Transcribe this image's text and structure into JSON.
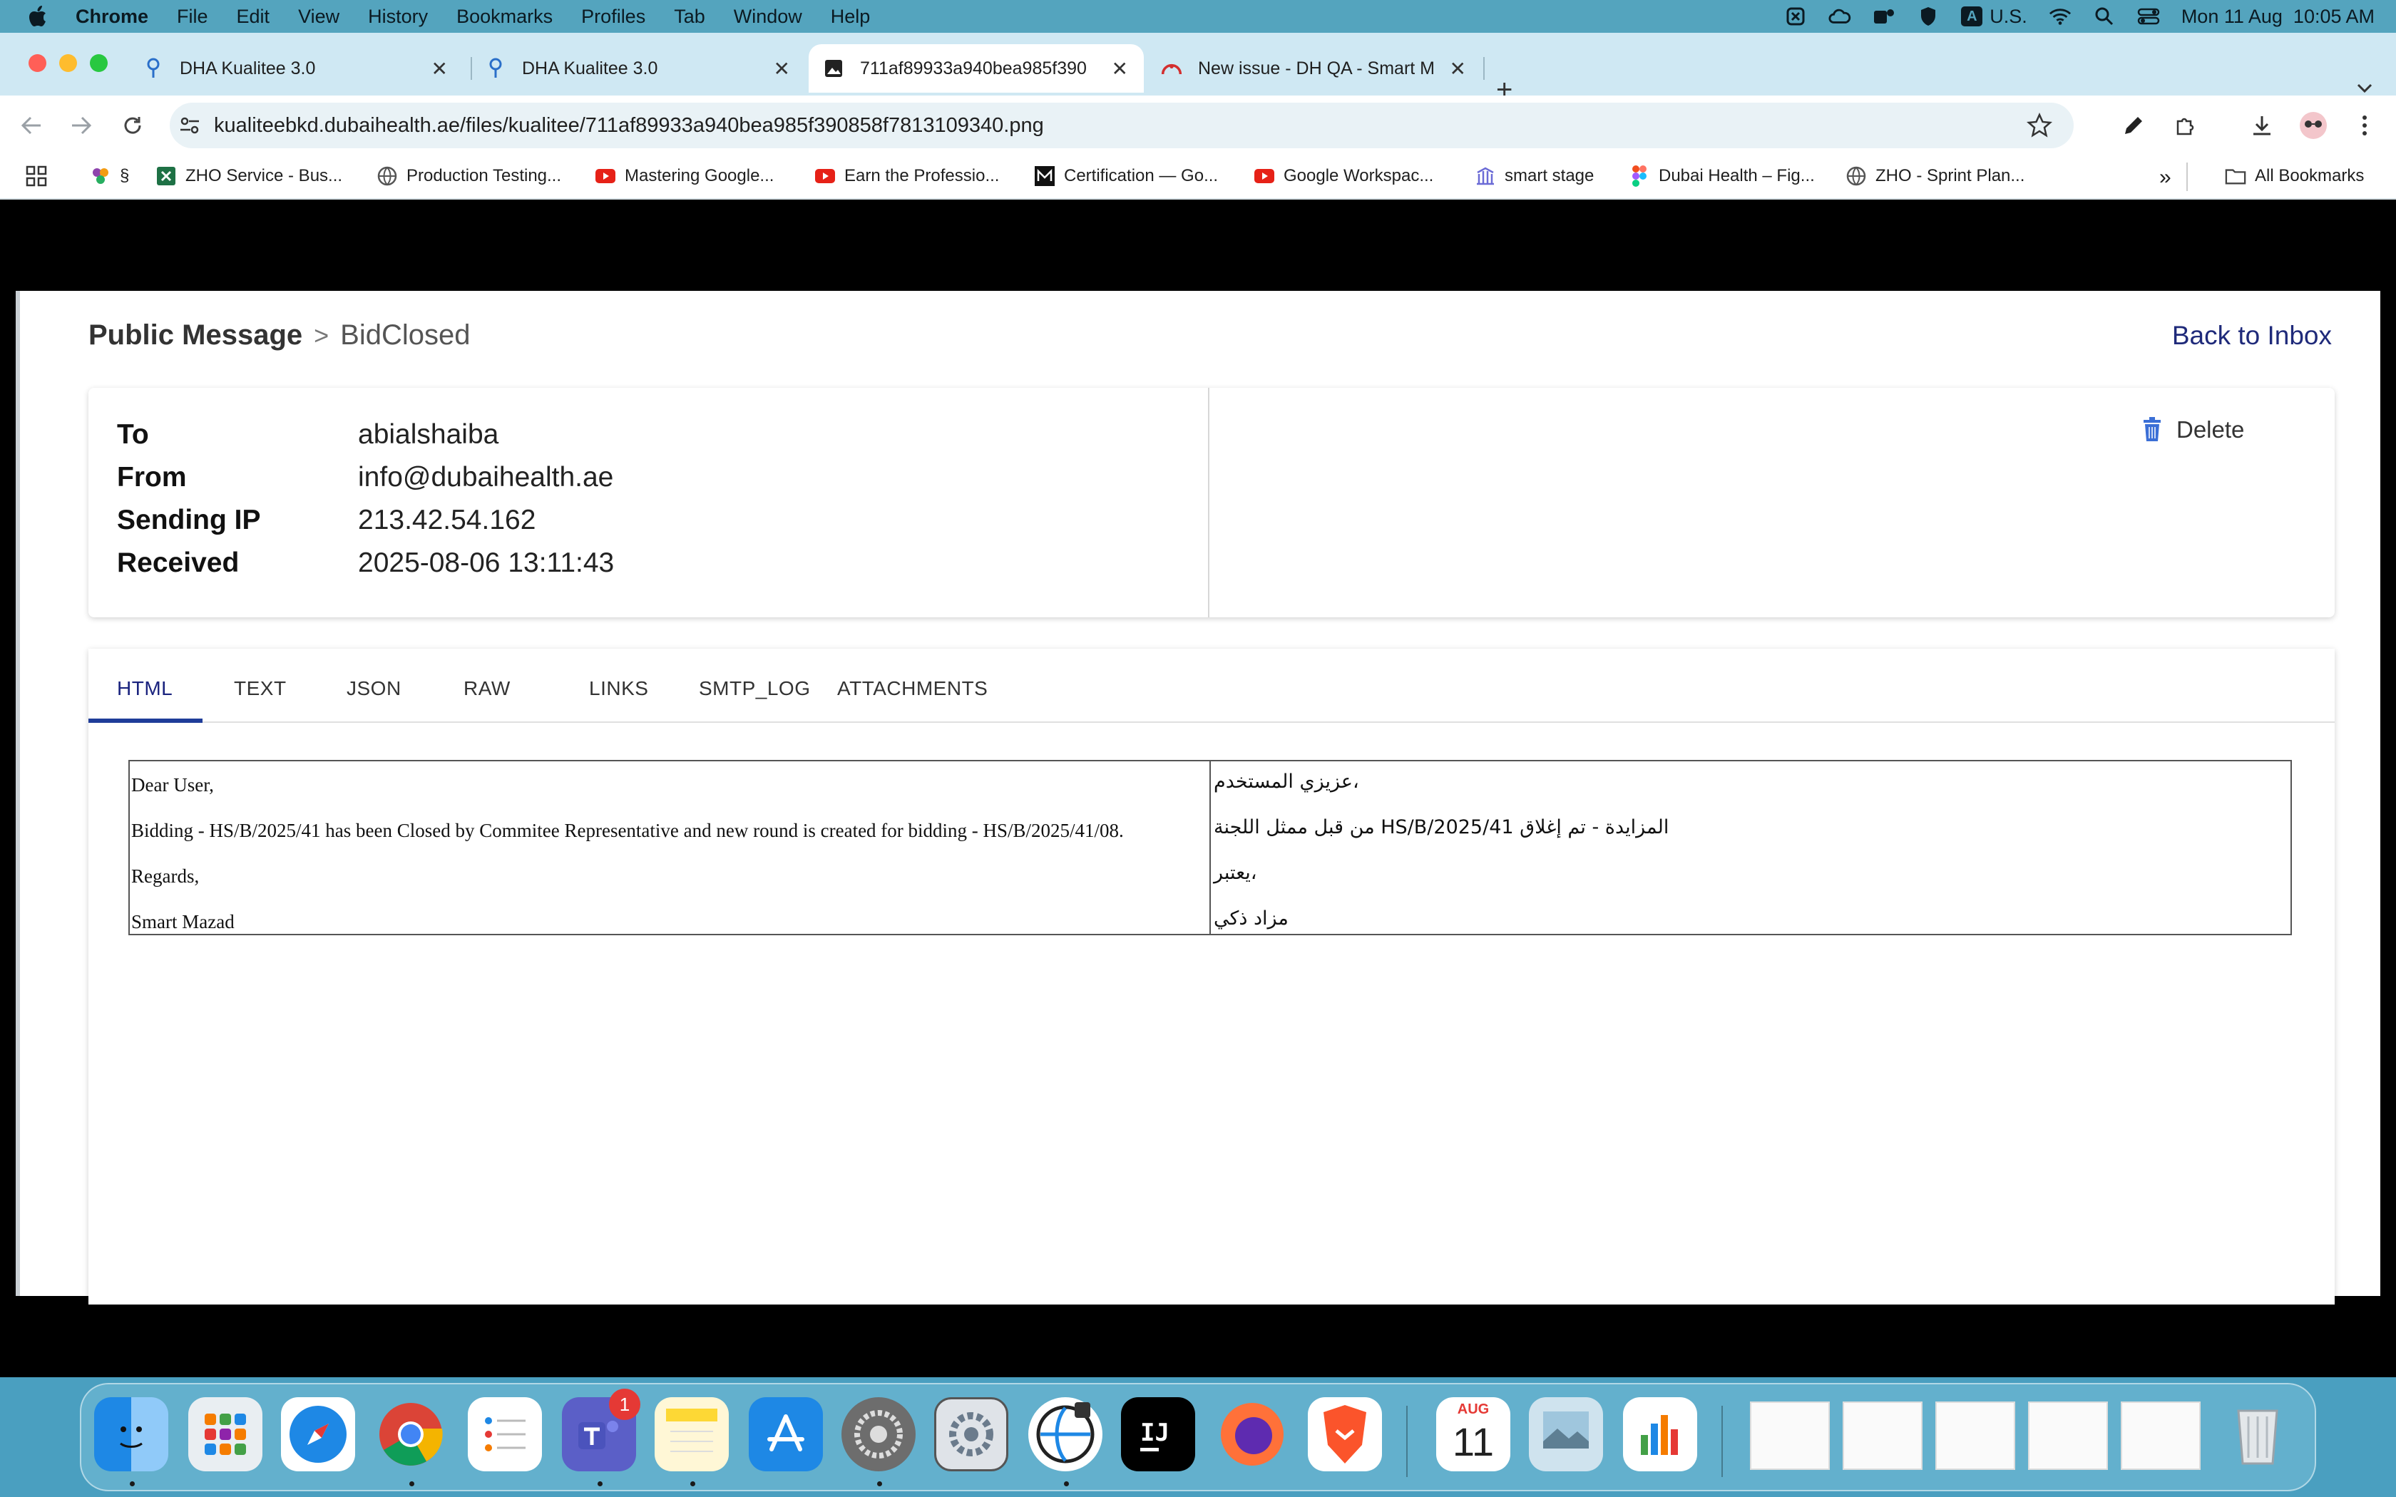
{
  "menubar": {
    "app": "Chrome",
    "items": [
      "File",
      "Edit",
      "View",
      "History",
      "Bookmarks",
      "Profiles",
      "Tab",
      "Window",
      "Help"
    ],
    "input_source": "U.S.",
    "input_badge": "A",
    "datetime": "Mon 11 Aug  10:05 AM"
  },
  "tabs": [
    {
      "title": "DHA Kualitee 3.0"
    },
    {
      "title": "DHA Kualitee 3.0"
    },
    {
      "title": "711af89933a940bea985f390"
    },
    {
      "title": "New issue - DH QA - Smart M"
    }
  ],
  "address": {
    "url": "kualiteebkd.dubaihealth.ae/files/kualitee/711af89933a940bea985f390858f7813109340.png"
  },
  "bookmarks": {
    "items": [
      {
        "label": "§"
      },
      {
        "label": "ZHO Service - Bus..."
      },
      {
        "label": "Production Testing..."
      },
      {
        "label": "Mastering Google..."
      },
      {
        "label": "Earn the Professio..."
      },
      {
        "label": "Certification — Go..."
      },
      {
        "label": "Google Workspac..."
      },
      {
        "label": "smart stage"
      },
      {
        "label": "Dubai Health – Fig..."
      },
      {
        "label": "ZHO - Sprint Plan..."
      }
    ],
    "more": "»",
    "all_bookmarks": "All Bookmarks"
  },
  "message": {
    "breadcrumb_root": "Public Message",
    "breadcrumb_sep": ">",
    "breadcrumb_current": "BidClosed",
    "back_link": "Back to Inbox",
    "delete_label": "Delete",
    "fields": [
      {
        "label": "To",
        "value": "abialshaiba"
      },
      {
        "label": "From",
        "value": "info@dubaihealth.ae"
      },
      {
        "label": "Sending IP",
        "value": "213.42.54.162"
      },
      {
        "label": "Received",
        "value": "2025-08-06 13:11:43"
      }
    ],
    "tabs": [
      "HTML",
      "TEXT",
      "JSON",
      "RAW",
      "LINKS",
      "SMTP_LOG",
      "ATTACHMENTS"
    ],
    "active_tab": "HTML",
    "body_en": [
      "Dear User,",
      "Bidding - HS/B/2025/41  has been Closed by Commitee Representative and new round is created for bidding - HS/B/2025/41/08.",
      "Regards,",
      "Smart Mazad"
    ],
    "body_ar": [
      "عزيزي المستخدم،",
      "من قبل ممثل اللجنة HS/B/2025/41 المزايدة - تم إغلاق",
      "يعتبر،",
      "مزاد ذكي"
    ]
  },
  "dock": {
    "calendar_month": "AUG",
    "calendar_day": "11",
    "teams_badge": "1"
  },
  "colors": {
    "menubar": "#54a4be",
    "tabstrip": "#cfe8f3",
    "link": "#1f2a7a",
    "active_tab_indicator": "#1f3d99",
    "delete_icon": "#3b6fd6"
  }
}
